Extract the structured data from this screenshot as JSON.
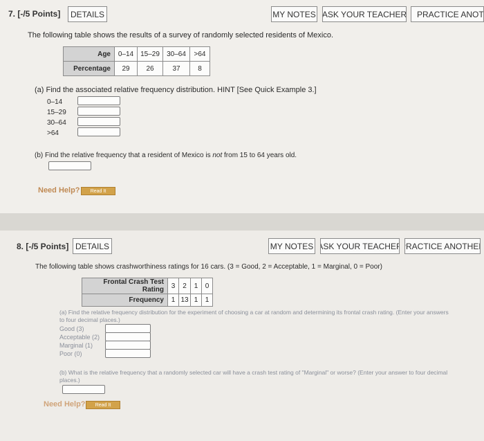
{
  "q7": {
    "number": "7.  [-/5 Points]",
    "details": "DETAILS",
    "my_notes": "MY NOTES",
    "ask_teacher": "ASK YOUR TEACHER",
    "practice": "PRACTICE ANOTHER",
    "intro": "The following table shows the results of a survey of randomly selected residents of Mexico.",
    "table": {
      "row1_header": "Age",
      "row1": [
        "0–14",
        "15–29",
        "30–64",
        ">64"
      ],
      "row2_header": "Percentage",
      "row2": [
        "29",
        "26",
        "37",
        "8"
      ]
    },
    "part_a": "(a)  Find the associated relative frequency distribution. HINT [See Quick Example 3.]",
    "rows": [
      "0–14",
      "15–29",
      "30–64",
      ">64"
    ],
    "part_b_pre": "(b)  Find the relative frequency that a resident of Mexico is ",
    "part_b_em": "not",
    "part_b_post": " from 15 to 64 years old.",
    "need_help": "Need Help?",
    "read_it": "Read It"
  },
  "q8": {
    "number": "8.  [-/5 Points]",
    "details": "DETAILS",
    "my_notes": "MY NOTES",
    "ask_teacher": "ASK YOUR TEACHER",
    "practice": "PRACTICE ANOTHER",
    "intro": "The following table shows crashworthiness ratings for 16 cars. (3 = Good, 2 = Acceptable, 1 = Marginal, 0 = Poor)",
    "table": {
      "row1_header": "Frontal Crash Test Rating",
      "row1": [
        "3",
        "2",
        "1",
        "0"
      ],
      "row2_header": "Frequency",
      "row2": [
        "1",
        "13",
        "1",
        "1"
      ]
    },
    "part_a_line1": "(a) Find the relative frequency distribution for the experiment of choosing a car at random and determining its frontal crash rating. (Enter your answers",
    "part_a_line2": "to four decimal places.)",
    "rows": [
      "Good (3)",
      "Acceptable (2)",
      "Marginal (1)",
      "Poor (0)"
    ],
    "part_b_line1": "(b) What is the relative frequency that a randomly selected car will have a crash test rating of \"Marginal\" or worse? (Enter your answer to four decimal",
    "part_b_line2": "places.)",
    "need_help": "Need Help?",
    "read_it": "Read It"
  }
}
